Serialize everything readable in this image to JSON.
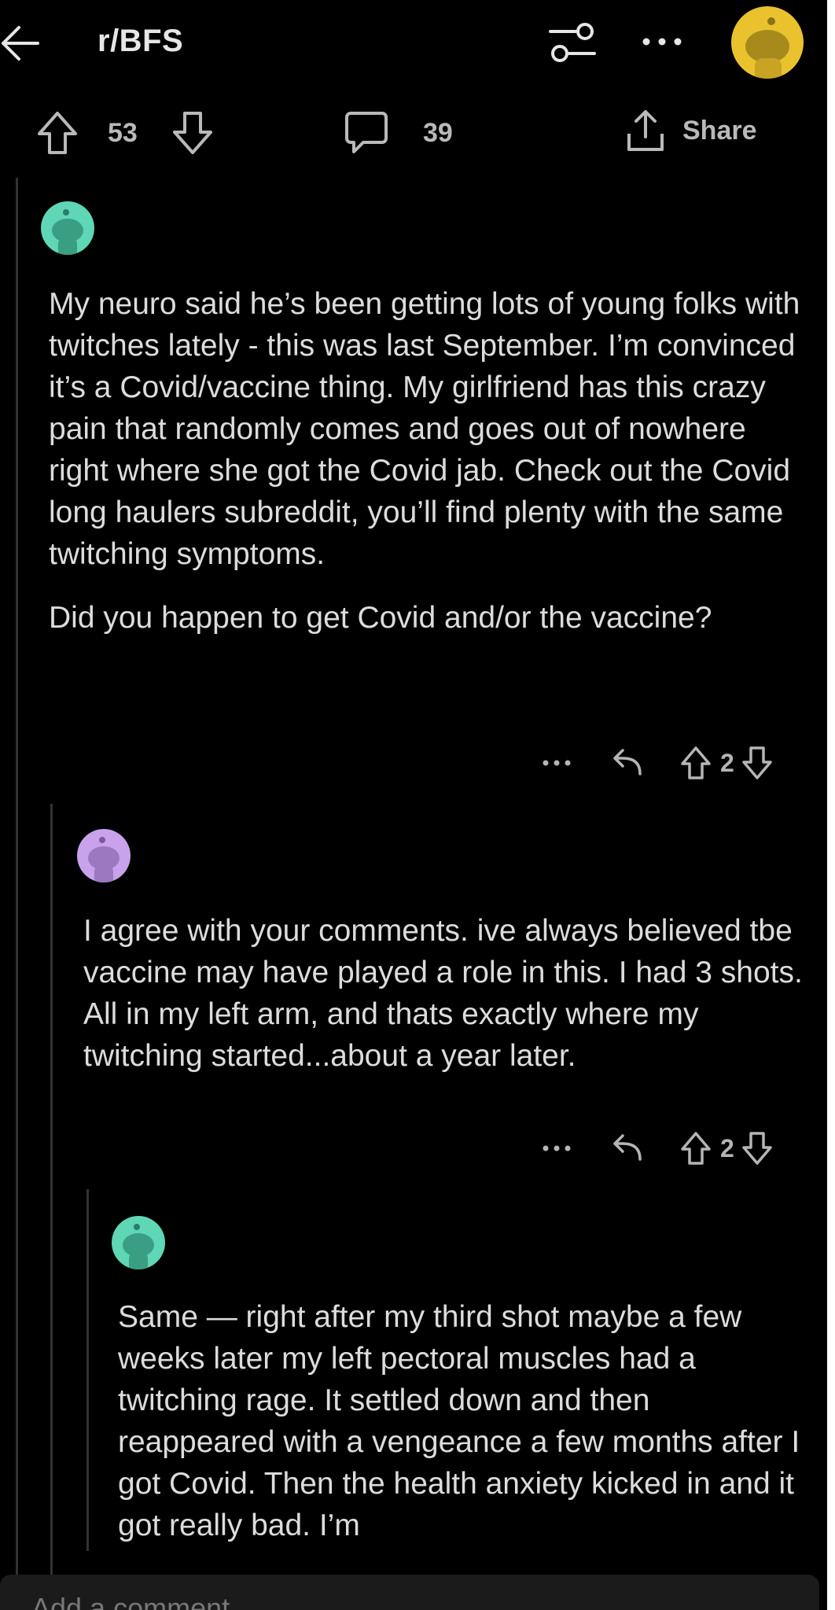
{
  "header": {
    "subreddit": "r/BFS"
  },
  "post_actions": {
    "upvotes": "53",
    "comments": "39",
    "share_label": "Share"
  },
  "comments": [
    {
      "paragraphs": [
        "My neuro said he’s been getting lots of young folks with twitches lately - this was last September. I’m convinced it’s a Covid/vaccine thing. My girlfriend has this crazy pain that randomly comes and goes out of nowhere right where she got the Covid jab. Check out the Covid long haulers subreddit, you’ll find plenty with the same twitching symptoms.",
        "Did you happen to get Covid and/or the vaccine?"
      ],
      "score": "2",
      "avatar_color": "#5fd6b6"
    },
    {
      "paragraphs": [
        "I agree with your comments.  ive always believed tbe vaccine may have played a role in this.  I had 3 shots.  All in my left arm, and thats exactly where my twitching started...about a year later."
      ],
      "score": "2",
      "avatar_color": "#c8a2ea"
    },
    {
      "paragraphs": [
        "Same — right after my third shot maybe a few weeks later my left pectoral muscles had a twitching rage. It settled down and then reappeared with a vengeance a few months after I got Covid. Then the health anxiety kicked in and it got really bad. I’m"
      ],
      "avatar_color": "#5fd6b6"
    }
  ],
  "composer": {
    "placeholder": "Add a comment"
  },
  "colors": {
    "background": "#000000",
    "text": "#dcdcdc",
    "profile_avatar": "#e9c22e"
  }
}
